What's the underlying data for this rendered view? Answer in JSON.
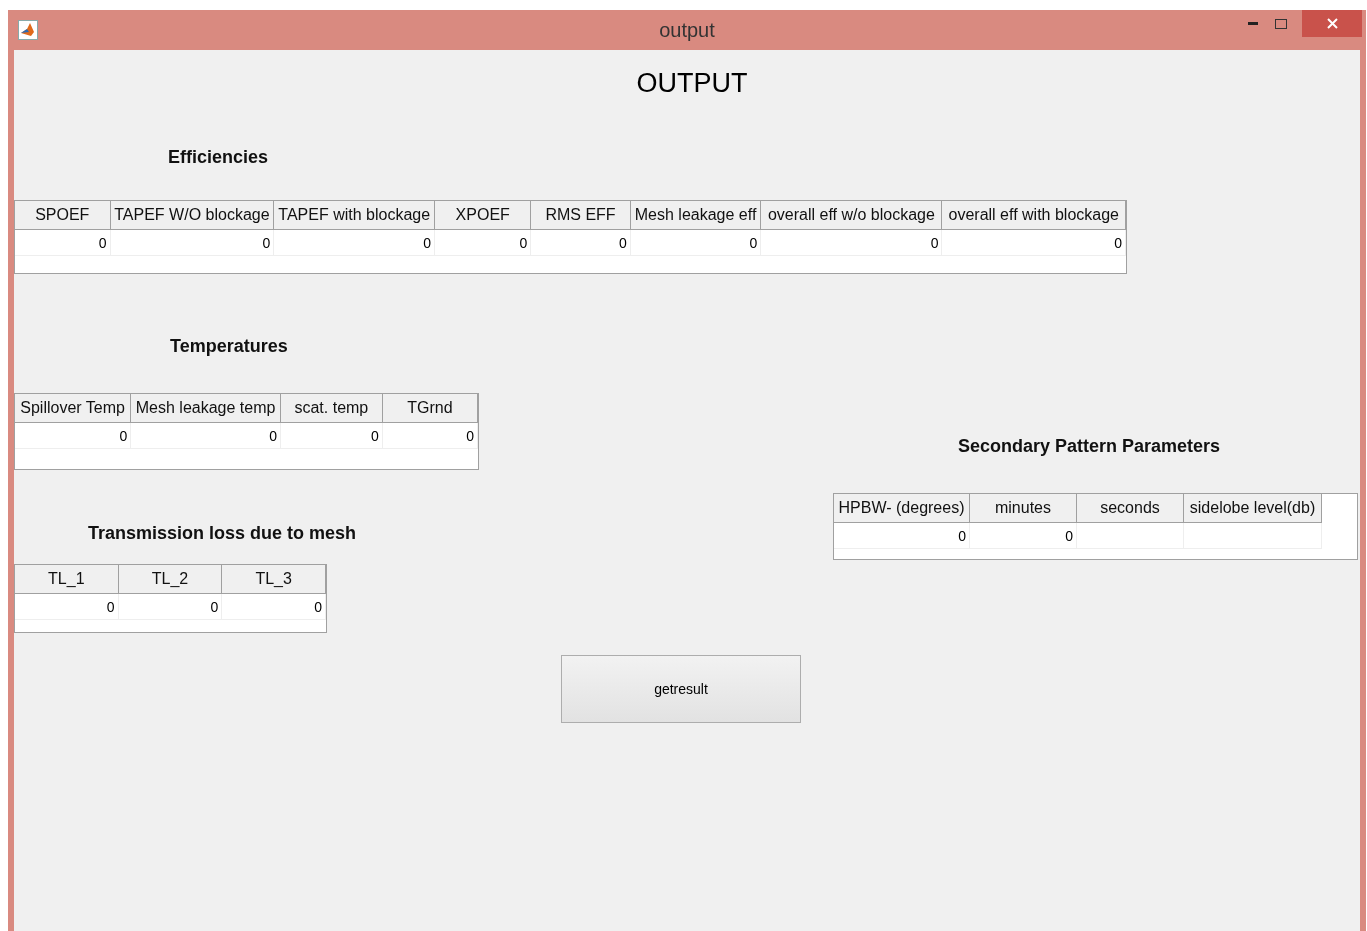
{
  "window": {
    "title": "output"
  },
  "heading": "OUTPUT",
  "efficiencies": {
    "title": "Efficiencies",
    "columns": [
      "SPOEF",
      "TAPEF W/O blockage",
      "TAPEF with blockage",
      "XPOEF",
      "RMS EFF",
      "Mesh leakage eff",
      "overall eff w/o blockage",
      "overall eff with blockage"
    ],
    "rows": [
      [
        "0",
        "0",
        "0",
        "0",
        "0",
        "0",
        "0",
        "0"
      ]
    ]
  },
  "temperatures": {
    "title": "Temperatures",
    "columns": [
      "Spillover Temp",
      "Mesh leakage temp",
      "scat. temp",
      "TGrnd"
    ],
    "rows": [
      [
        "0",
        "0",
        "0",
        "0"
      ]
    ]
  },
  "transmission_loss": {
    "title": "Transmission loss due to mesh",
    "columns": [
      "TL_1",
      "TL_2",
      "TL_3"
    ],
    "rows": [
      [
        "0",
        "0",
        "0"
      ]
    ]
  },
  "secondary_pattern": {
    "title": "Secondary Pattern Parameters",
    "columns": [
      "HPBW- (degrees)",
      "minutes",
      "seconds",
      "sidelobe level(db)"
    ],
    "rows": [
      [
        "0",
        "0",
        null,
        null
      ]
    ]
  },
  "button": {
    "label": "getresult"
  }
}
